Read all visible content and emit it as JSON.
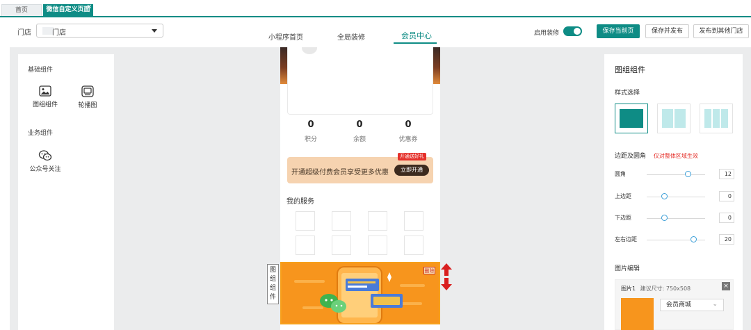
{
  "tabs": {
    "home": "首页",
    "active": "微信自定义页面",
    "close": "×"
  },
  "header": {
    "store_label": "门店",
    "store_value": "门店",
    "nav": [
      "小程序首页",
      "全局装修",
      "会员中心"
    ],
    "toggle_label": "启用装修",
    "toggle_on": true,
    "buttons": {
      "save_current": "保存当前页",
      "save_publish": "保存并发布",
      "publish_other": "发布到其他门店"
    }
  },
  "left": {
    "basic_title": "基础组件",
    "basic_items": [
      {
        "label": "图组组件",
        "icon": "image-icon"
      },
      {
        "label": "轮播图",
        "icon": "carousel-icon"
      }
    ],
    "biz_title": "业务组件",
    "biz_items": [
      {
        "label": "公众号关注",
        "icon": "wechat-icon"
      }
    ]
  },
  "phone": {
    "stats": [
      {
        "value": "0",
        "label": "积分"
      },
      {
        "value": "0",
        "label": "余额"
      },
      {
        "value": "0",
        "label": "优惠券"
      }
    ],
    "vip_text": "开通超级付费会员享受更多优惠",
    "vip_button": "立即开通",
    "vip_tag": "开通送好礼",
    "services_title": "我的服务",
    "delete_tag": "删除",
    "side_tag": [
      "图",
      "组",
      "组",
      "件"
    ]
  },
  "right": {
    "title": "图组组件",
    "style_title": "样式选择",
    "spacing_title": "边距及圆角",
    "spacing_hint": "仅对整体区域生效",
    "sliders": [
      {
        "label": "圆角",
        "value": "12",
        "level": 0.7
      },
      {
        "label": "上边距",
        "value": "0",
        "level": 0.3
      },
      {
        "label": "下边距",
        "value": "0",
        "level": 0.3
      },
      {
        "label": "左右边距",
        "value": "20",
        "level": 0.8
      }
    ],
    "image_edit_title": "图片编辑",
    "image_item": {
      "name": "图片1",
      "size": "建议尺寸: 750x508",
      "link": "会员商城",
      "close": "×"
    }
  },
  "colors": {
    "accent": "#0e8c85",
    "orange": "#f7951d",
    "danger": "#e5302a"
  }
}
